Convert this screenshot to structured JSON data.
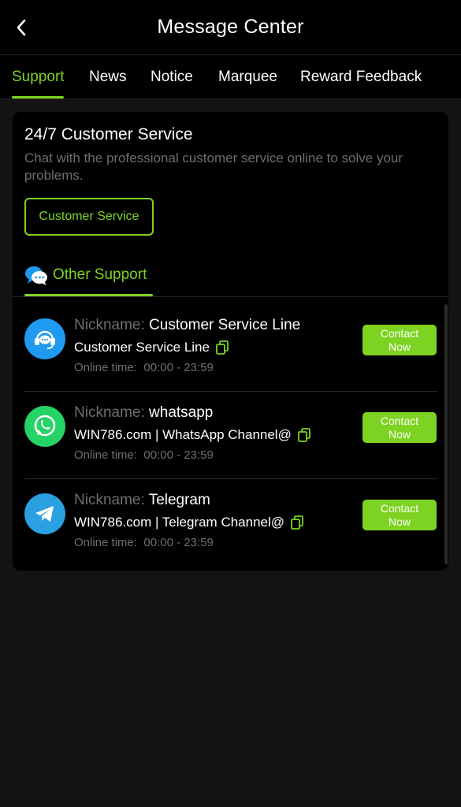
{
  "header": {
    "title": "Message Center",
    "back_icon": "chevron-left-icon"
  },
  "tabs": [
    {
      "label": "Support",
      "active": true
    },
    {
      "label": "News",
      "active": false
    },
    {
      "label": "Notice",
      "active": false
    },
    {
      "label": "Marquee",
      "active": false
    },
    {
      "label": "Reward Feedback",
      "active": false
    }
  ],
  "support": {
    "title": "24/7 Customer Service",
    "description": "Chat with the professional customer service online to solve your problems.",
    "button_label": "Customer Service",
    "other_support_label": "Other Support",
    "other_support_icon": "chat-bubbles-icon"
  },
  "contacts": [
    {
      "icon": "headset-icon",
      "nickname_label": "Nickname:",
      "nickname": "Customer Service Line",
      "channel": "Customer Service Line",
      "online_label": "Online time:",
      "online_time": "00:00 - 23:59",
      "button_label": "Contact Now"
    },
    {
      "icon": "whatsapp-icon",
      "nickname_label": "Nickname:",
      "nickname": "whatsapp",
      "channel": "WIN786.com | WhatsApp Channel@",
      "online_label": "Online time:",
      "online_time": "00:00 - 23:59",
      "button_label": "Contact Now"
    },
    {
      "icon": "telegram-icon",
      "nickname_label": "Nickname:",
      "nickname": "Telegram",
      "channel": "WIN786.com | Telegram Channel@",
      "online_label": "Online time:",
      "online_time": "00:00 - 23:59",
      "button_label": "Contact Now"
    }
  ],
  "colors": {
    "accent": "#7ed322",
    "background": "#131313",
    "card": "#000000",
    "muted_text": "#6e6e6e",
    "whatsapp": "#25d366",
    "service_blue": "#1e9bf0",
    "telegram_blue": "#2aa0e0"
  }
}
